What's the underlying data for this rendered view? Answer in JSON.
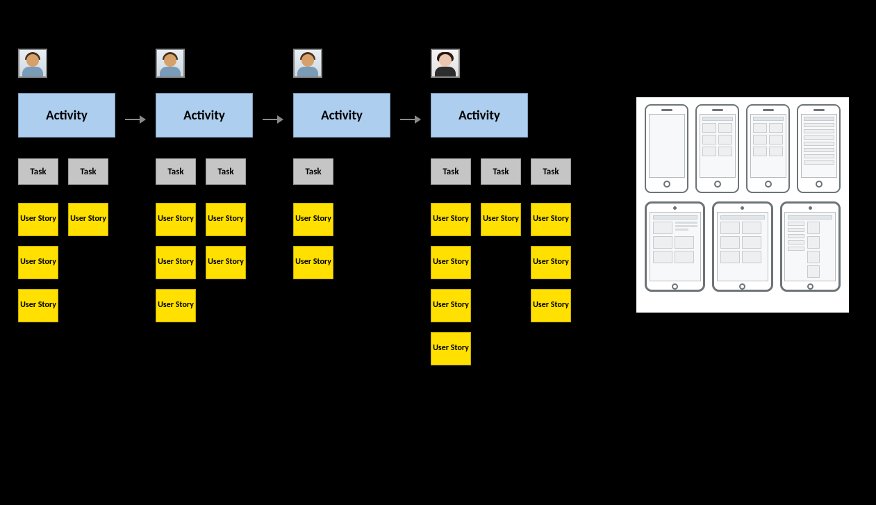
{
  "labels": {
    "activity": "Activity",
    "task": "Task",
    "story": "User\nStory"
  },
  "personas": {
    "male": "persona-male",
    "female": "persona-female"
  },
  "columns": [
    {
      "persona": "male",
      "activity": "Activity",
      "tasks": [
        "Task",
        "Task"
      ],
      "story_stacks": [
        [
          "User Story",
          "User Story",
          "User Story"
        ],
        [
          "User Story"
        ]
      ]
    },
    {
      "persona": "male",
      "activity": "Activity",
      "tasks": [
        "Task",
        "Task"
      ],
      "story_stacks": [
        [
          "User Story",
          "User Story",
          "User Story"
        ],
        [
          "User Story",
          "User Story"
        ]
      ]
    },
    {
      "persona": "male",
      "activity": "Activity",
      "tasks": [
        "Task"
      ],
      "story_stacks": [
        [
          "User Story",
          "User Story"
        ]
      ]
    },
    {
      "persona": "female",
      "activity": "Activity",
      "tasks": [
        "Task",
        "Task",
        "Task"
      ],
      "story_stacks": [
        [
          "User Story",
          "User Story",
          "User Story",
          "User Story"
        ],
        [
          "User Story"
        ],
        [
          "User Story",
          "User Story",
          "User Story"
        ]
      ]
    }
  ],
  "colors": {
    "activity_bg": "#adceee",
    "task_bg": "#c5c5c5",
    "story_bg": "#ffe000",
    "background": "#000000"
  },
  "wireframes": {
    "phones": [
      "blank",
      "grid",
      "grid",
      "list"
    ],
    "tablets": [
      "text-grid",
      "grid",
      "list-grid"
    ]
  }
}
